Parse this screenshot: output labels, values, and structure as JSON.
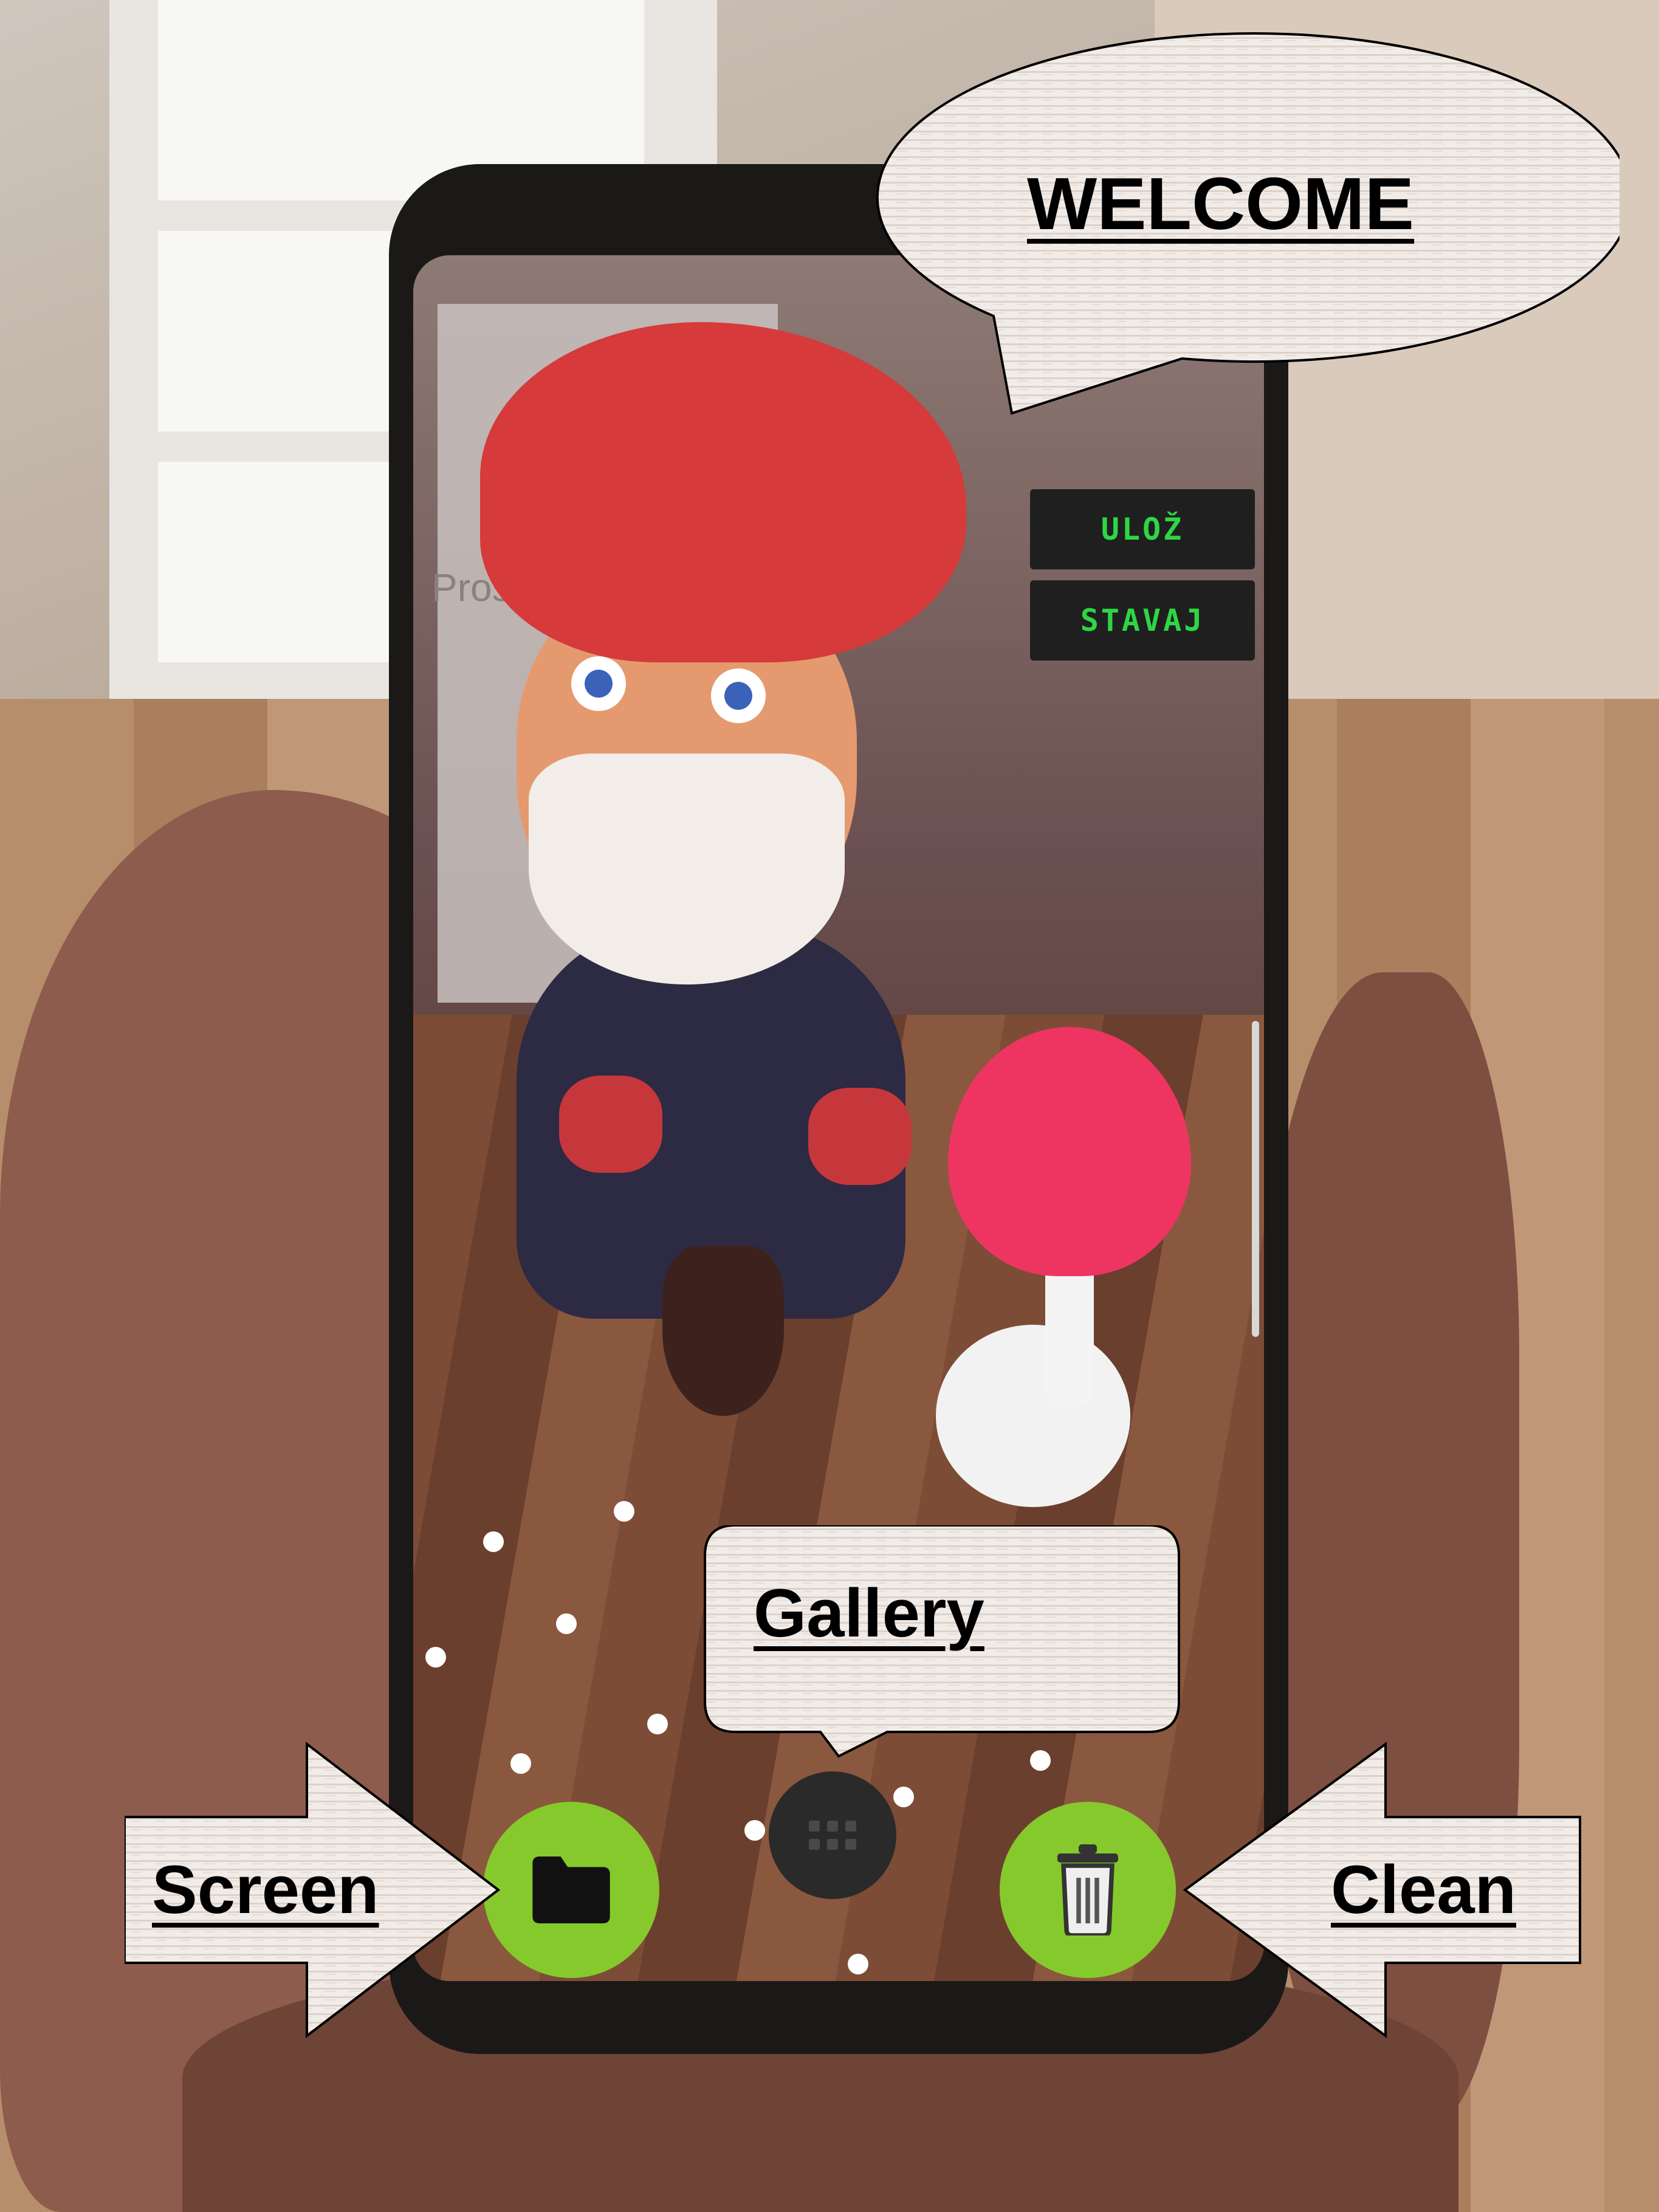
{
  "callouts": {
    "welcome": "WELCOME",
    "gallery": "Gallery",
    "screen": "Screen",
    "clean": "Clean"
  },
  "app": {
    "hint_text": "Prosím vyplňte mi...",
    "buttons": {
      "save_label": "ULOŽ",
      "build_label": "STAVAJ"
    },
    "bottom_bar": {
      "folder_icon": "folder-icon",
      "gallery_icon": "grid-icon",
      "trash_icon": "trash-icon"
    }
  },
  "colors": {
    "accent_green": "#86c92c",
    "ar_text_green": "#2ed645",
    "ar_button_bg": "#1f1f1f"
  }
}
